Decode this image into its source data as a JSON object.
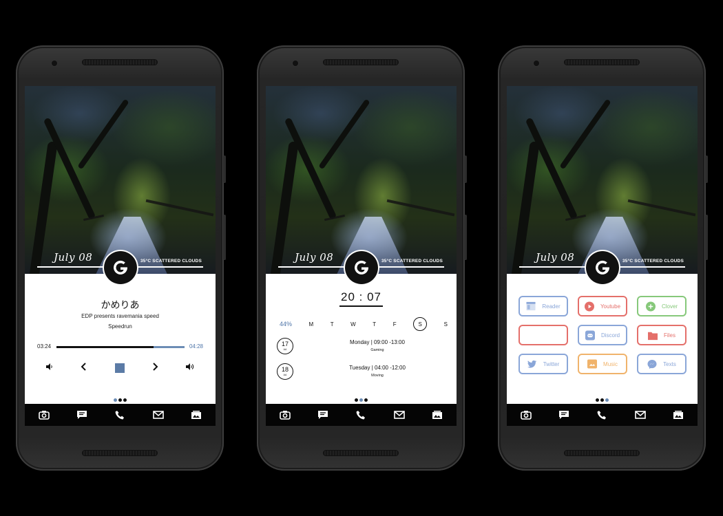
{
  "colors": {
    "accent": "#6b8cb5",
    "background": "#000000",
    "red": "#e46f6a",
    "green": "#86c87a",
    "blue": "#8aa6d8",
    "orange": "#f0b36b"
  },
  "header": {
    "date": "July 08",
    "weather": "35°C SCATTERED CLOUDS",
    "badge": "G"
  },
  "dock": {
    "icons": [
      "camera-icon",
      "messages-icon",
      "phone-icon",
      "gmail-icon",
      "gallery-icon"
    ]
  },
  "music": {
    "title": "かめりあ",
    "artist": "EDP presents ravemania speed",
    "album": "Speedrun",
    "elapsed": "03:24",
    "duration": "04:28",
    "progress": 0.76,
    "controls": [
      "volume-down-icon",
      "previous-icon",
      "stop-icon",
      "next-icon",
      "volume-up-icon"
    ]
  },
  "calendar": {
    "time": "20 : 07",
    "battery": "44%",
    "weekdays": [
      "M",
      "T",
      "W",
      "T",
      "F",
      "S",
      "S"
    ],
    "today_index": 5,
    "events": [
      {
        "day": "17",
        "month": "AA",
        "title": "Monday | 09:00 -13:00",
        "subtitle": "Gaming"
      },
      {
        "day": "18",
        "month": "AA",
        "title": "Tuesday | 04:00 -12:00",
        "subtitle": "Moving"
      }
    ]
  },
  "apps": [
    {
      "label": "Reader",
      "icon": "reader-icon",
      "color": "#8aa6d8"
    },
    {
      "label": "Youtube",
      "icon": "youtube-icon",
      "color": "#e46f6a"
    },
    {
      "label": "Clover",
      "icon": "clover-icon",
      "color": "#86c87a"
    },
    {
      "label": "",
      "icon": "",
      "color": "#e46f6a"
    },
    {
      "label": "Discord",
      "icon": "discord-icon",
      "color": "#8aa6d8"
    },
    {
      "label": "Files",
      "icon": "files-icon",
      "color": "#e46f6a"
    },
    {
      "label": "Twitter",
      "icon": "twitter-icon",
      "color": "#8aa6d8"
    },
    {
      "label": "Music",
      "icon": "music-icon",
      "color": "#f0b36b"
    },
    {
      "label": "Texts",
      "icon": "messenger-icon",
      "color": "#8aa6d8"
    }
  ],
  "pages": {
    "page1_active": 0,
    "page2_active": 1,
    "page3_active": 2
  }
}
